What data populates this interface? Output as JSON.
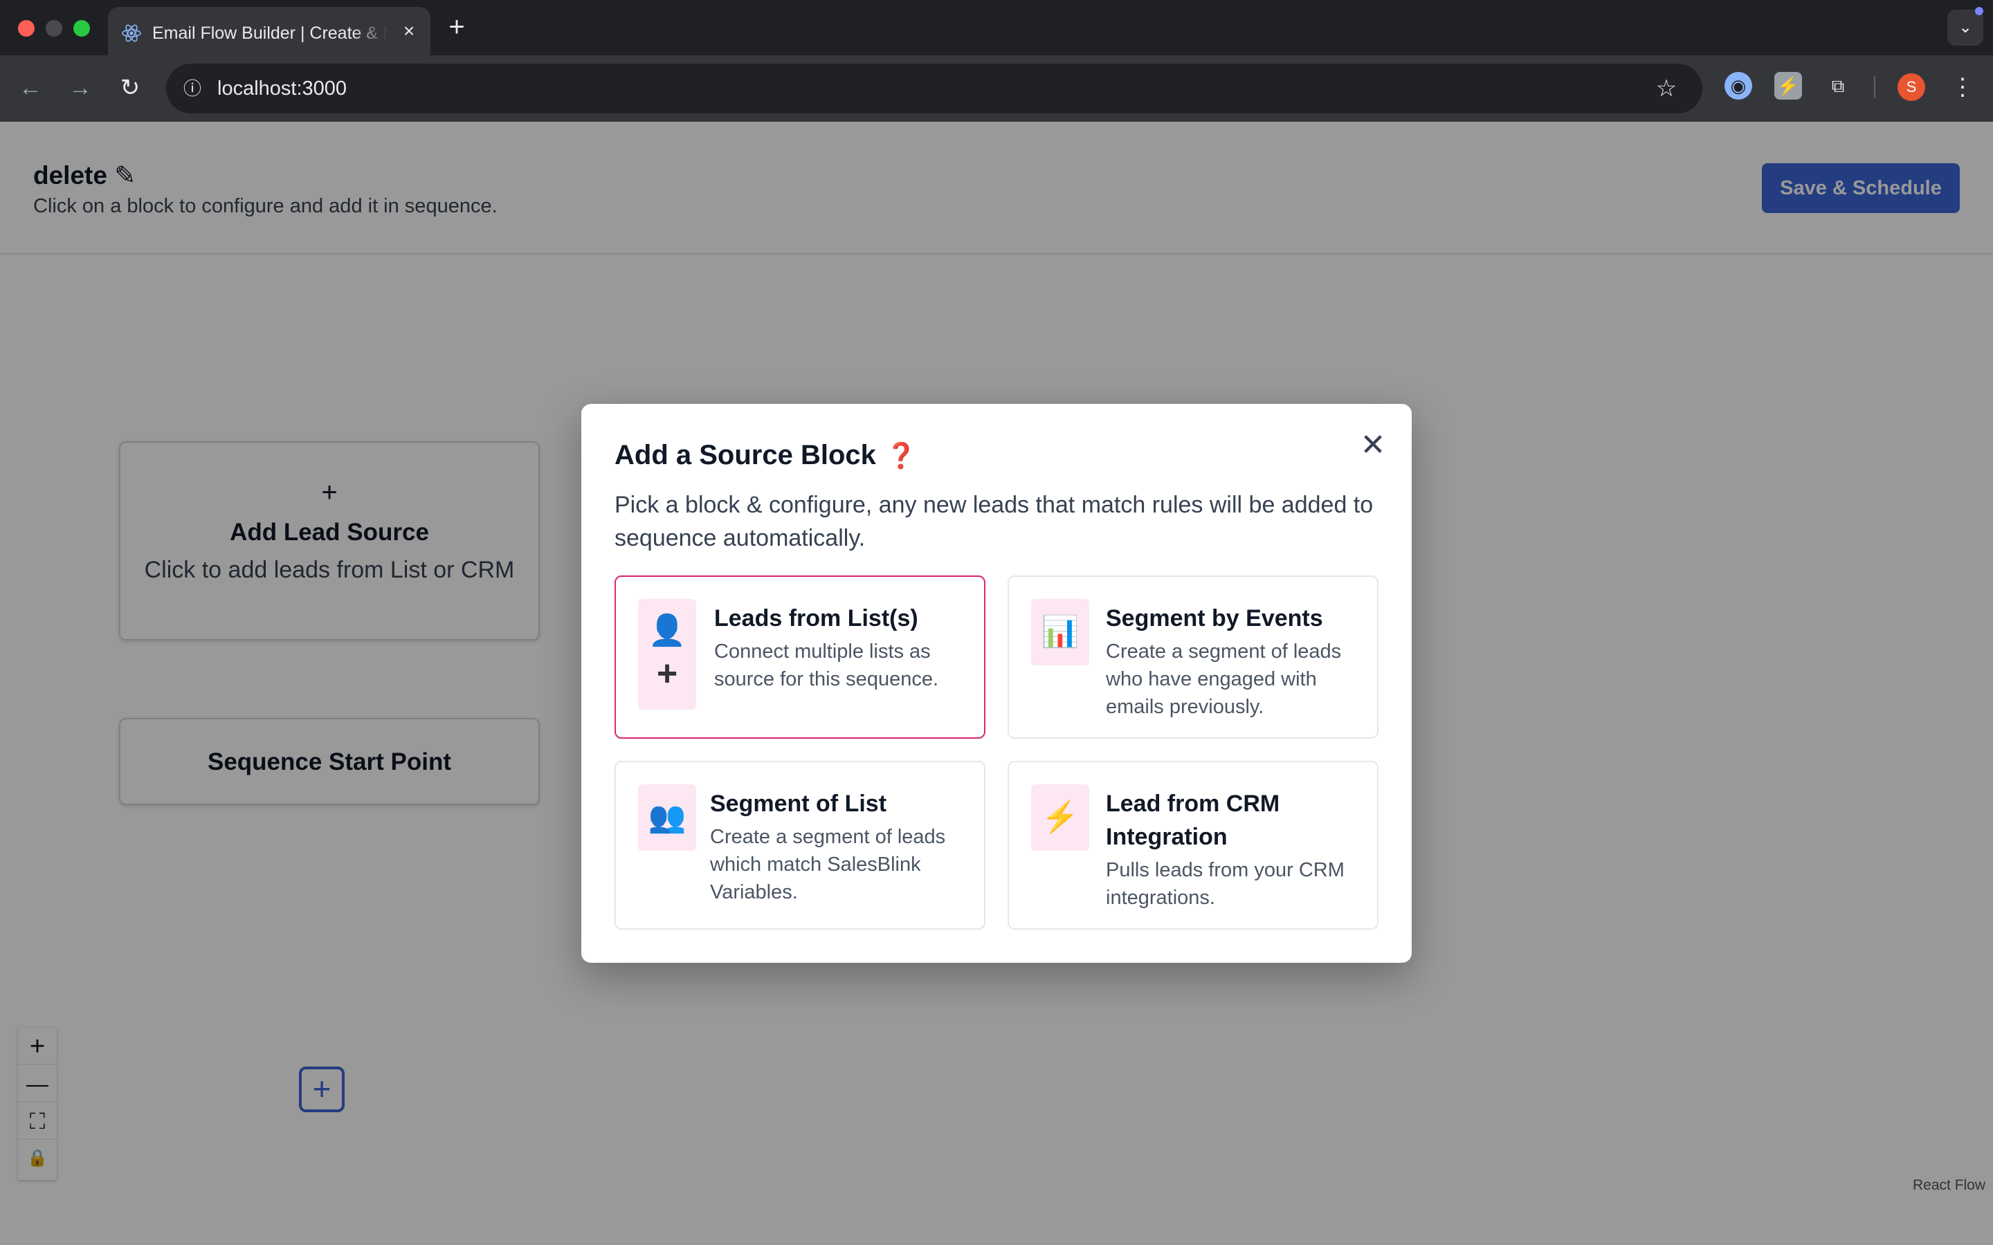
{
  "browser": {
    "tab_title": "Email Flow Builder | Create & Manage Email Sequences",
    "url": "localhost:3000",
    "profile_initial": "S"
  },
  "app": {
    "flow_name": "delete",
    "edit_icon": "✎",
    "subtitle": "Click on a block to configure and add it in sequence.",
    "save_button": "Save & Schedule"
  },
  "canvas": {
    "lead_node": {
      "plus": "+",
      "title": "Add Lead Source",
      "subtitle": "Click to add leads from List or CRM"
    },
    "start_node": {
      "title": "Sequence Start Point"
    },
    "add_node_plus": "+",
    "controls": {
      "zoom_in": "+",
      "zoom_out": "—",
      "fit_view": "⛶",
      "lock": "🔒"
    },
    "attribution": "React Flow"
  },
  "modal": {
    "title": "Add a Source Block",
    "help_icon": "❓",
    "close": "✕",
    "description": "Pick a block & configure, any new leads that match rules will be added to sequence automatically.",
    "cards": [
      {
        "icon": "👤",
        "icon_extra": "+",
        "title": "Leads from List(s)",
        "description": "Connect multiple lists as source for this sequence.",
        "selected": true
      },
      {
        "icon": "📊",
        "title": "Segment by Events",
        "description": "Create a segment of leads who have engaged with emails previously.",
        "selected": false
      },
      {
        "icon": "👥",
        "title": "Segment of List",
        "description": "Create a segment of leads which match SalesBlink Variables.",
        "selected": false
      },
      {
        "icon": "⚡",
        "title": "Lead from CRM Integration",
        "description": "Pulls leads from your CRM integrations.",
        "selected": false
      }
    ]
  },
  "colors": {
    "accent": "#3b66d6",
    "selected_border": "#db2777",
    "icon_bg": "#fce7f3",
    "help": "#dc2626"
  }
}
